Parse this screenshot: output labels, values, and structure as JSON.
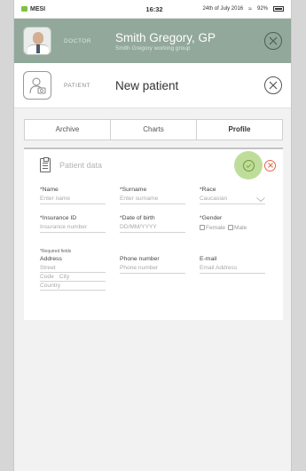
{
  "status_bar": {
    "brand": "MESI",
    "time": "16:32",
    "date": "24th of July 2016",
    "battery": "92%"
  },
  "doctor": {
    "role_label": "DOCTOR",
    "name": "Smith Gregory, GP",
    "group": "Smith Gregory working group"
  },
  "patient": {
    "role_label": "PATIENT",
    "name": "New patient"
  },
  "tabs": [
    {
      "label": "Archive"
    },
    {
      "label": "Charts"
    },
    {
      "label": "Profile"
    }
  ],
  "form": {
    "title": "Patient data",
    "name": {
      "label": "*Name",
      "placeholder": "Enter name"
    },
    "surname": {
      "label": "*Surname",
      "placeholder": "Enter surname"
    },
    "race": {
      "label": "*Race",
      "value": "Caucasian"
    },
    "insurance": {
      "label": "*Insurance ID",
      "placeholder": "Insurance number"
    },
    "dob": {
      "label": "*Date of birth",
      "placeholder": "DD/MM/YYYY"
    },
    "gender": {
      "label": "*Gender",
      "options": [
        "Female",
        "Male"
      ]
    },
    "required_note": "*Required fields",
    "address": {
      "label": "Address",
      "street": "Street",
      "code": "Code",
      "city": "City",
      "country": "Country"
    },
    "phone": {
      "label": "Phone number",
      "placeholder": "Phone number"
    },
    "email": {
      "label": "E-mail",
      "placeholder": "Email Address"
    }
  },
  "colors": {
    "doctor_header": "#92a89b",
    "brand_green": "#7cc242",
    "confirm_glow": "#aad278",
    "cancel_red": "#e5654a"
  }
}
